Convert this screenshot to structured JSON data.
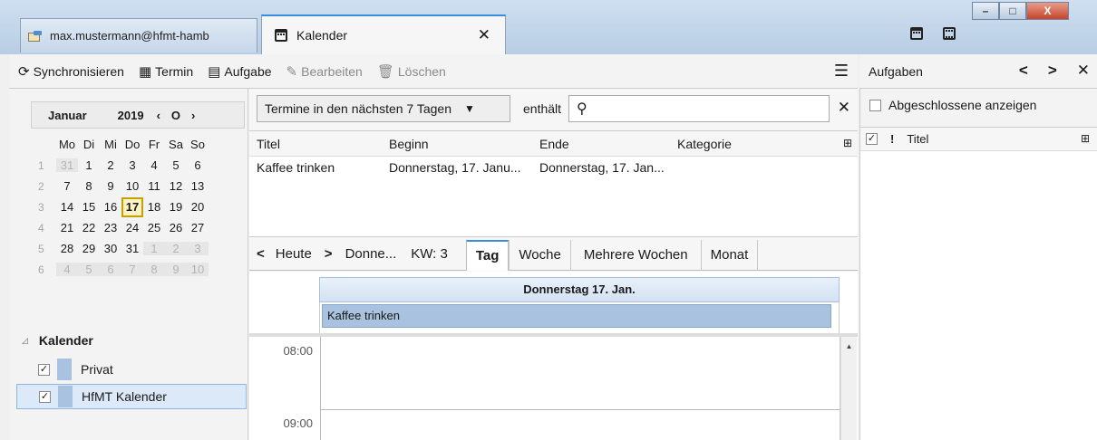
{
  "window": {
    "mail_tab_label": "max.mustermann@hfmt-hamb",
    "calendar_tab_label": "Kalender",
    "close_glyph": "✕"
  },
  "toolbar": {
    "sync": "Synchronisieren",
    "event": "Termin",
    "task": "Aufgabe",
    "edit": "Bearbeiten",
    "delete": "Löschen"
  },
  "tasks_header": {
    "label": "Aufgaben"
  },
  "minicalendar": {
    "month": "Januar",
    "year": "2019",
    "weekdays": [
      "Mo",
      "Di",
      "Mi",
      "Do",
      "Fr",
      "Sa",
      "So"
    ],
    "weeks": [
      {
        "wk": "1",
        "days": [
          "31",
          "1",
          "2",
          "3",
          "4",
          "5",
          "6"
        ]
      },
      {
        "wk": "2",
        "days": [
          "7",
          "8",
          "9",
          "10",
          "11",
          "12",
          "13"
        ]
      },
      {
        "wk": "3",
        "days": [
          "14",
          "15",
          "16",
          "17",
          "18",
          "19",
          "20"
        ]
      },
      {
        "wk": "4",
        "days": [
          "21",
          "22",
          "23",
          "24",
          "25",
          "26",
          "27"
        ]
      },
      {
        "wk": "5",
        "days": [
          "28",
          "29",
          "30",
          "31",
          "1",
          "2",
          "3"
        ]
      },
      {
        "wk": "6",
        "days": [
          "4",
          "5",
          "6",
          "7",
          "8",
          "9",
          "10"
        ]
      }
    ],
    "today": "17"
  },
  "calendars": {
    "heading": "Kalender",
    "items": [
      {
        "label": "Privat",
        "color": "#a8c2df"
      },
      {
        "label": "HfMT Kalender",
        "color": "#a8c2df"
      }
    ]
  },
  "filter": {
    "range": "Termine in den nächsten 7 Tagen",
    "contains": "enthält",
    "search_value": ""
  },
  "eventlist": {
    "columns": [
      "Titel",
      "Beginn",
      "Ende",
      "Kategorie"
    ],
    "rows": [
      {
        "title": "Kaffee trinken",
        "start": "Donnerstag, 17. Janu...",
        "end": "Donnerstag, 17. Jan...",
        "category": ""
      }
    ]
  },
  "views": {
    "today": "Heute",
    "current": "Donne...",
    "week_no": "KW: 3",
    "tabs": [
      "Tag",
      "Woche",
      "Mehrere Wochen",
      "Monat"
    ],
    "active_tab": "Tag"
  },
  "dayview": {
    "header": "Donnerstag 17. Jan.",
    "allday_event": "Kaffee trinken",
    "hours": [
      "08:00",
      "09:00"
    ]
  },
  "taskpane": {
    "show_completed": "Abgeschlossene anzeigen",
    "title_column": "Titel"
  }
}
